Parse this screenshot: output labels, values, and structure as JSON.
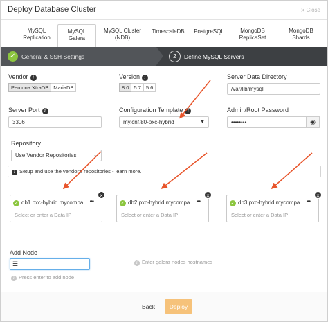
{
  "dialog": {
    "title": "Deploy Database Cluster",
    "close_label": "Close"
  },
  "tabs": [
    {
      "line1": "MySQL",
      "line2": "Replication"
    },
    {
      "line1": "MySQL",
      "line2": "Galera"
    },
    {
      "line1": "MySQL Cluster",
      "line2": "(NDB)"
    },
    {
      "line1": "TimescaleDB",
      "line2": ""
    },
    {
      "line1": "PostgreSQL",
      "line2": ""
    },
    {
      "line1": "MongoDB",
      "line2": "ReplicaSet"
    },
    {
      "line1": "MongoDB",
      "line2": "Shards"
    }
  ],
  "active_tab": "MySQL Galera",
  "steps": {
    "step1_label": "General & SSH Settings",
    "step2_number": "2",
    "step2_label": "Define MySQL Servers"
  },
  "form": {
    "vendor_label": "Vendor",
    "vendor_options": [
      "Percona XtraDB",
      "MariaDB"
    ],
    "version_label": "Version",
    "version_options": [
      "8.0",
      "5.7",
      "5.6"
    ],
    "data_dir_label": "Server Data Directory",
    "data_dir_value": "/var/lib/mysql",
    "port_label": "Server Port",
    "port_value": "3306",
    "config_label": "Configuration Template",
    "config_value": "my.cnf.80-pxc-hybrid",
    "password_label": "Admin/Root Password",
    "password_value": "••••••••",
    "repo_label": "Repository",
    "repo_value": "Use Vendor Repositories",
    "repo_note": "Setup and use the vendor's repositories - learn more."
  },
  "nodes": [
    {
      "host": "db1.pxc-hybrid.mycompa",
      "more": "•••",
      "ip_placeholder": "Select or enter a Data IP"
    },
    {
      "host": "db2.pxc-hybrid.mycompa",
      "more": "•••",
      "ip_placeholder": "Select or enter a Data IP"
    },
    {
      "host": "db3.pxc-hybrid.mycompa",
      "more": "•••",
      "ip_placeholder": "Select or enter a Data IP"
    }
  ],
  "add_node": {
    "label": "Add Node",
    "hint": "Press enter to add node",
    "galera_hint": "Enter galera nodes hostnames"
  },
  "footer": {
    "back_label": "Back",
    "deploy_label": "Deploy"
  },
  "icons": {
    "info": "info-icon",
    "check": "check-icon",
    "remove": "remove-icon",
    "eye": "eye-icon",
    "list": "list-icon"
  },
  "colors": {
    "steps_bar": "#3d4043",
    "check_green": "#8cc63f",
    "deploy_button": "#f6c27a",
    "arrow_red": "#e8542a"
  }
}
